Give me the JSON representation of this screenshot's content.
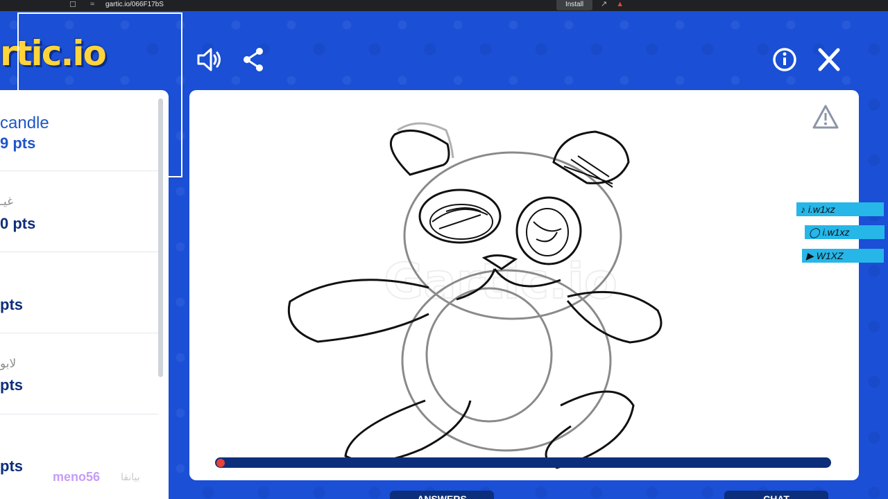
{
  "browser": {
    "url": "gartic.io/066F17bS",
    "install_label": "Install"
  },
  "logo": {
    "text": "rtic.io"
  },
  "players": [
    {
      "name": "candle",
      "points": "9 pts"
    },
    {
      "name": "غيـ",
      "points": "0 pts"
    },
    {
      "name": "",
      "points": "pts"
    },
    {
      "name": "لابو",
      "points": "pts"
    },
    {
      "name": "",
      "points": "pts"
    }
  ],
  "watermark": {
    "user": "meno56",
    "arabic": "بيانقا"
  },
  "social": {
    "tiktok": "i.w1xz",
    "instagram": "i.w1xz",
    "youtube": "W1XZ"
  },
  "bottom_tabs": {
    "answers": "ANSWERS",
    "chat": "CHAT"
  },
  "progress": {
    "fraction": 0.01
  },
  "colors": {
    "background": "#1a4fd6",
    "navy": "#0d2e7a",
    "accent": "#ffd43b",
    "timer": "#e94235",
    "social": "#26b6e8"
  },
  "icons": [
    "sound-icon",
    "share-icon",
    "info-icon",
    "close-icon",
    "warning-icon",
    "bookmark-icon",
    "tiktok-icon",
    "instagram-icon",
    "youtube-icon"
  ]
}
